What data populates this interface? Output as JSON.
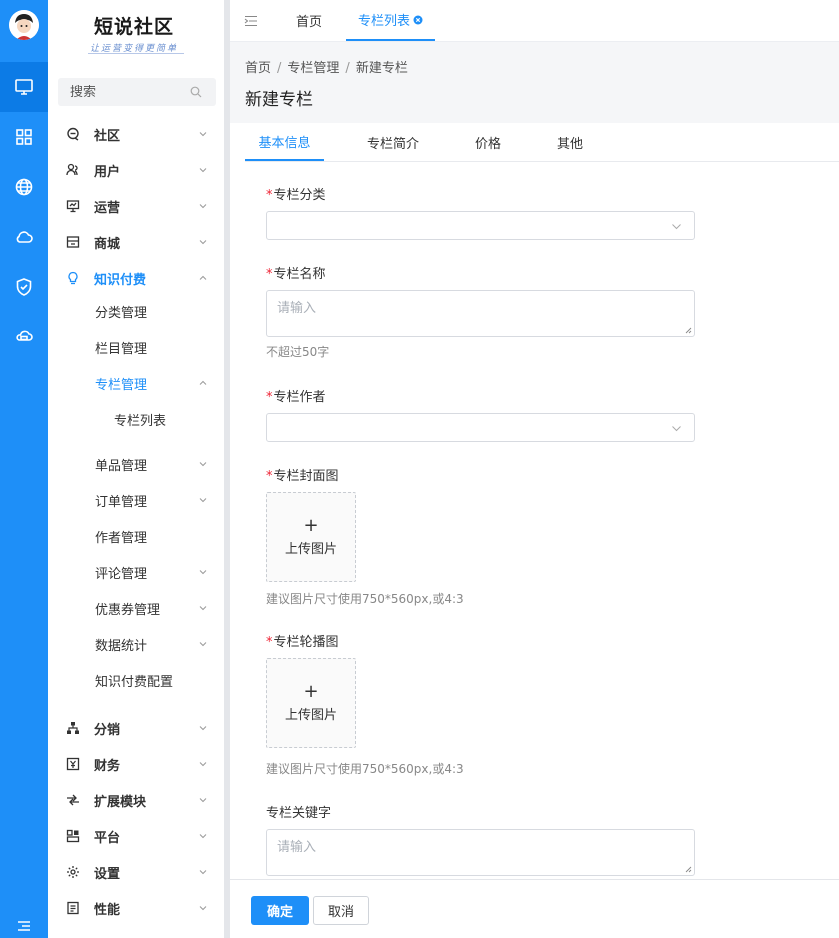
{
  "app": {
    "logo_title": "短说社区",
    "logo_subtitle": "让运营变得更简单"
  },
  "search": {
    "placeholder": "搜索"
  },
  "sidebar": {
    "items": [
      {
        "label": "社区",
        "icon": "chat-icon"
      },
      {
        "label": "用户",
        "icon": "users-icon"
      },
      {
        "label": "运营",
        "icon": "presentation-icon"
      },
      {
        "label": "商城",
        "icon": "store-icon"
      },
      {
        "label": "知识付费",
        "icon": "lightbulb-icon",
        "expanded": true
      },
      {
        "label": "分类管理"
      },
      {
        "label": "栏目管理"
      },
      {
        "label": "专栏管理",
        "expanded": true
      },
      {
        "label": "专栏列表"
      },
      {
        "label": "单品管理"
      },
      {
        "label": "订单管理"
      },
      {
        "label": "作者管理"
      },
      {
        "label": "评论管理"
      },
      {
        "label": "优惠券管理"
      },
      {
        "label": "数据统计"
      },
      {
        "label": "知识付费配置"
      },
      {
        "label": "分销",
        "icon": "network-icon"
      },
      {
        "label": "财务",
        "icon": "finance-icon"
      },
      {
        "label": "扩展模块",
        "icon": "extension-icon"
      },
      {
        "label": "平台",
        "icon": "platform-icon"
      },
      {
        "label": "设置",
        "icon": "gear-icon"
      },
      {
        "label": "性能",
        "icon": "performance-icon"
      }
    ]
  },
  "topbar": {
    "tabs": [
      {
        "label": "首页"
      },
      {
        "label": "专栏列表"
      }
    ]
  },
  "breadcrumb": {
    "items": [
      "首页",
      "专栏管理",
      "新建专栏"
    ],
    "separator": "/"
  },
  "page": {
    "title": "新建专栏"
  },
  "subtabs": [
    "基本信息",
    "专栏简介",
    "价格",
    "其他"
  ],
  "form": {
    "category_label": "专栏分类",
    "name_label": "专栏名称",
    "name_placeholder": "请输入",
    "name_hint": "不超过50字",
    "author_label": "专栏作者",
    "cover_label": "专栏封面图",
    "upload_text": "上传图片",
    "upload_plus": "+",
    "cover_hint": "建议图片尺寸使用750*560px,或4:3",
    "carousel_label": "专栏轮播图",
    "carousel_hint": "建议图片尺寸使用750*560px,或4:3",
    "keyword_label": "专栏关键字",
    "keyword_placeholder": "请输入",
    "required_mark": "*"
  },
  "footer": {
    "confirm_label": "确定",
    "cancel_label": "取消"
  },
  "colors": {
    "accent": "#1e8ff8",
    "rail_bg": "#1e8ff8",
    "required": "#ee2233"
  }
}
